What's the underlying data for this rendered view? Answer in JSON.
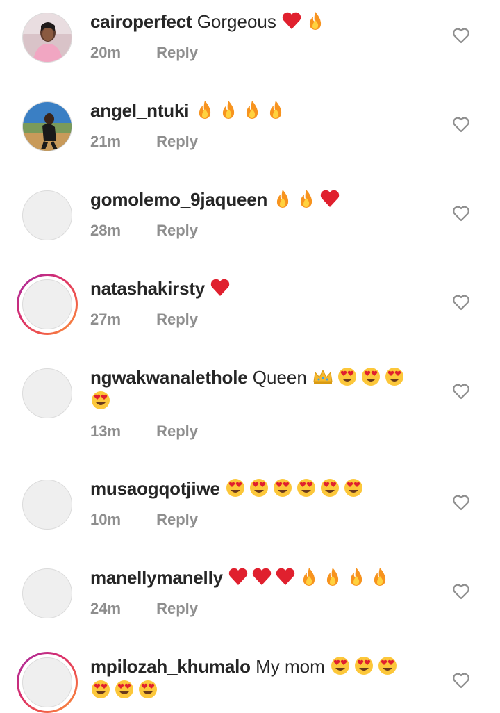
{
  "comments": [
    {
      "username": "cairoperfect",
      "text": "Gorgeous",
      "emojis": [
        "heart",
        "fire"
      ],
      "time": "20m",
      "reply": "Reply",
      "avatar": "photo"
    },
    {
      "username": "angel_ntuki",
      "text": "",
      "emojis": [
        "fire",
        "fire",
        "fire",
        "fire"
      ],
      "time": "21m",
      "reply": "Reply",
      "avatar": "photo"
    },
    {
      "username": "gomolemo_9jaqueen",
      "text": "",
      "emojis": [
        "fire",
        "fire",
        "heart"
      ],
      "time": "28m",
      "reply": "Reply",
      "avatar": "blank"
    },
    {
      "username": "natashakirsty",
      "text": "",
      "emojis": [
        "heart"
      ],
      "time": "27m",
      "reply": "Reply",
      "avatar": "story-ring"
    },
    {
      "username": "ngwakwanalethole",
      "text": "Queen",
      "emojis": [
        "crown",
        "heart-eyes",
        "heart-eyes",
        "heart-eyes",
        "heart-eyes"
      ],
      "time": "13m",
      "reply": "Reply",
      "avatar": "blank"
    },
    {
      "username": "musaogqotjiwe",
      "text": "",
      "emojis": [
        "heart-eyes",
        "heart-eyes",
        "heart-eyes",
        "heart-eyes",
        "heart-eyes",
        "heart-eyes"
      ],
      "time": "10m",
      "reply": "Reply",
      "avatar": "blank"
    },
    {
      "username": "manellymanelly",
      "text": "",
      "emojis": [
        "heart",
        "heart",
        "heart",
        "fire",
        "fire",
        "fire",
        "fire"
      ],
      "time": "24m",
      "reply": "Reply",
      "avatar": "blank"
    },
    {
      "username": "mpilozah_khumalo",
      "text": "My mom",
      "emojis": [
        "heart-eyes",
        "heart-eyes",
        "heart-eyes",
        "heart-eyes",
        "heart-eyes",
        "heart-eyes"
      ],
      "time": "",
      "reply": "",
      "avatar": "story-ring"
    }
  ],
  "icons": {
    "like": "heart-outline-icon"
  },
  "colors": {
    "username": "#262626",
    "meta": "#8e8e8e",
    "heart_emoji": "#e0202e",
    "fire_emoji": "#f7931e",
    "story_ring_start": "#a02da8",
    "story_ring_end": "#f9a03c"
  }
}
